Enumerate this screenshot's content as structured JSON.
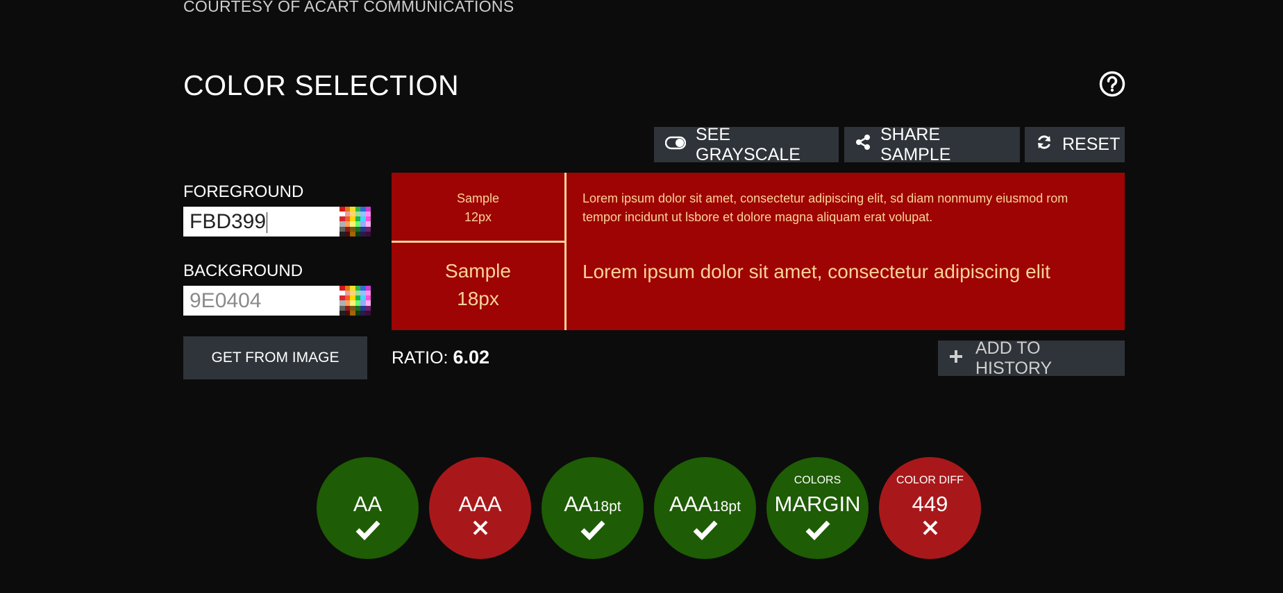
{
  "header": {
    "courtesy": "COURTESY OF ACART COMMUNICATIONS",
    "title": "COLOR SELECTION"
  },
  "toolbar": {
    "grayscale_label": "SEE GRAYSCALE",
    "share_label": "SHARE SAMPLE",
    "reset_label": "RESET"
  },
  "colors": {
    "foreground_label": "FOREGROUND",
    "foreground_value": "FBD399",
    "background_label": "BACKGROUND",
    "background_value": "9E0404",
    "foreground_hex": "#FBD399",
    "background_hex": "#9E0404",
    "get_from_image_label": "GET FROM IMAGE"
  },
  "sample": {
    "small_label_line1": "Sample",
    "small_label_line2": "12px",
    "large_label_line1": "Sample",
    "large_label_line2": "18px",
    "small_text": "Lorem ipsum dolor sit amet, consectetur adipiscing elit, sd diam nonmumy eiusmod rom tempor incidunt ut lsbore et dolore magna aliquam erat volupat.",
    "large_text": "Lorem ipsum dolor sit amet, consectetur adipiscing elit"
  },
  "ratio": {
    "label": "RATIO:",
    "value": "6.02"
  },
  "history": {
    "add_label": "ADD TO HISTORY"
  },
  "results": [
    {
      "main": "AA",
      "sub": "",
      "top": "",
      "status": "pass"
    },
    {
      "main": "AAA",
      "sub": "",
      "top": "",
      "status": "fail"
    },
    {
      "main": "AA",
      "sub": "18pt",
      "top": "",
      "status": "pass"
    },
    {
      "main": "AAA",
      "sub": "18pt",
      "top": "",
      "status": "pass"
    },
    {
      "main": "MARGIN",
      "sub": "",
      "top": "COLORS",
      "status": "pass"
    },
    {
      "main": "449",
      "sub": "",
      "top": "COLOR DIFF",
      "status": "fail"
    }
  ],
  "theme": {
    "pass_color": "#1e5c05",
    "fail_color": "#a8181a",
    "button_color": "#2f343a"
  },
  "icons": {
    "help": "help-circle-icon",
    "grayscale": "toggle-icon",
    "share": "share-icon",
    "reset": "refresh-icon",
    "picker": "palette-grid-icon",
    "add": "plus-icon",
    "pass": "check-icon",
    "fail": "cross-icon"
  }
}
